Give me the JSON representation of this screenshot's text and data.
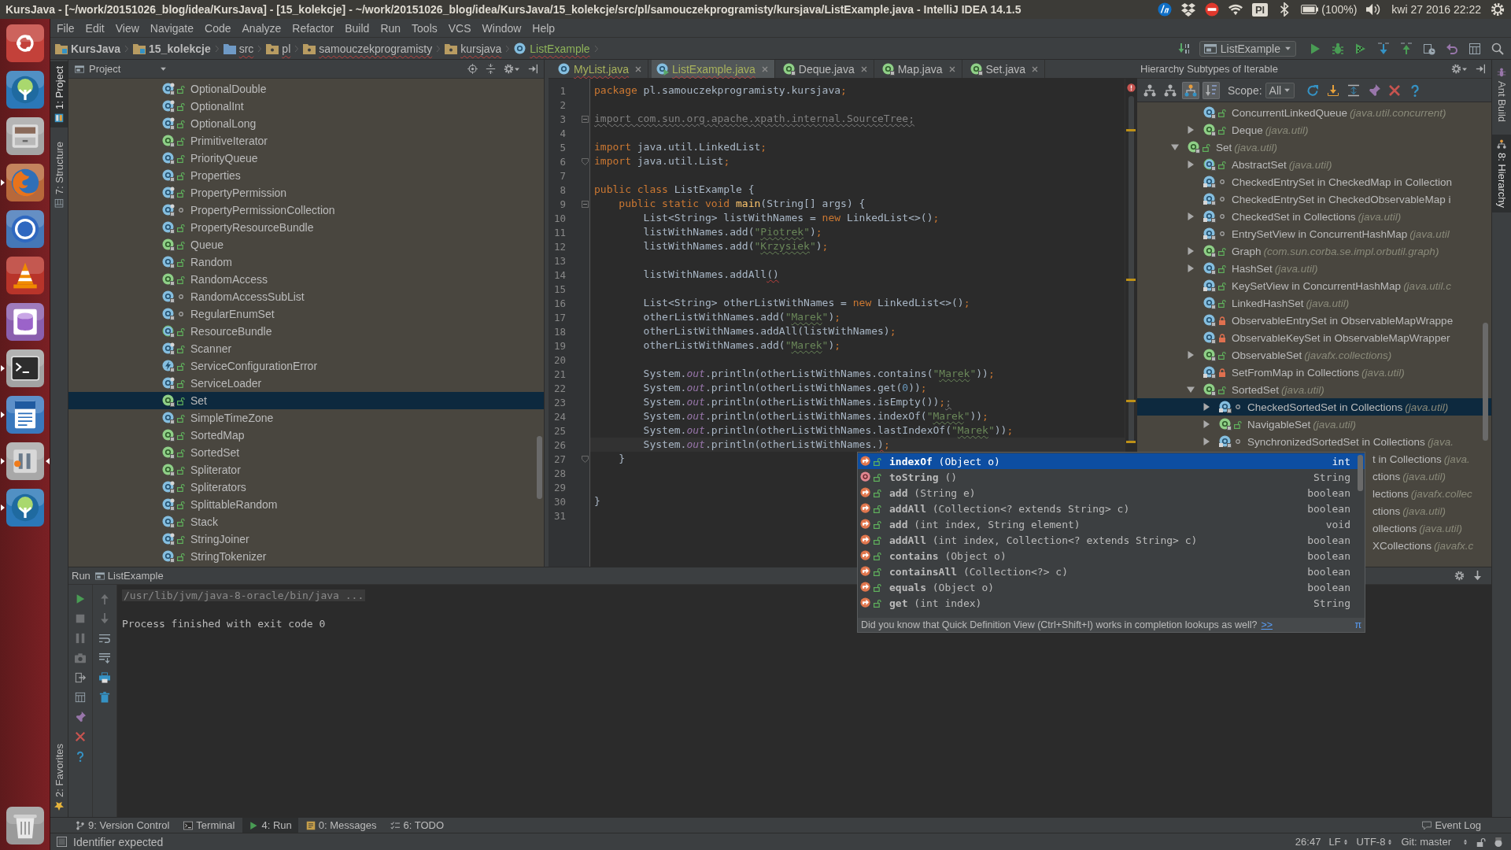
{
  "title_bar": {
    "title": "KursJava - [~/work/20151026_blog/idea/KursJava] - [15_kolekcje] - ~/work/20151026_blog/idea/KursJava/15_kolekcje/src/pl/samouczekprogramisty/kursjava/ListExample.java - IntelliJ IDEA 14.1.5",
    "indicators": [
      {
        "kind": "logo"
      },
      {
        "kind": "box"
      },
      {
        "kind": "blocked"
      },
      {
        "kind": "wifi"
      },
      {
        "kind": "keyboard",
        "label": "Pl"
      },
      {
        "kind": "bluetooth"
      },
      {
        "kind": "battery",
        "label": "(100%)"
      },
      {
        "kind": "volume"
      },
      {
        "kind": "clock",
        "label": "kwi 27 2016 22:22"
      },
      {
        "kind": "gear"
      }
    ]
  },
  "launcher": [
    {
      "kind": "dash",
      "running": false,
      "focused": false
    },
    {
      "kind": "tree",
      "running": false,
      "focused": false
    },
    {
      "kind": "drive",
      "running": false,
      "focused": false
    },
    {
      "kind": "browser",
      "running": true,
      "focused": false
    },
    {
      "kind": "torrent",
      "running": false,
      "focused": false
    },
    {
      "kind": "cone",
      "running": false,
      "focused": false
    },
    {
      "kind": "database",
      "running": false,
      "focused": false
    },
    {
      "kind": "terminal",
      "running": true,
      "focused": false
    },
    {
      "kind": "document",
      "running": true,
      "focused": false
    },
    {
      "kind": "ide",
      "running": true,
      "focused": true
    },
    {
      "kind": "tree",
      "running": true,
      "focused": false
    },
    {
      "kind": "trash",
      "running": false,
      "focused": false
    }
  ],
  "menu": [
    "File",
    "Edit",
    "View",
    "Navigate",
    "Code",
    "Analyze",
    "Refactor",
    "Build",
    "Run",
    "Tools",
    "VCS",
    "Window",
    "Help"
  ],
  "navigation": {
    "breadcrumbs": [
      {
        "label": "KursJava",
        "kind": "project",
        "added": false,
        "errors": false
      },
      {
        "label": "15_kolekcje",
        "kind": "module",
        "added": false,
        "errors": false
      },
      {
        "label": "src",
        "kind": "source",
        "added": false,
        "errors": true
      },
      {
        "label": "pl",
        "kind": "package",
        "added": false,
        "errors": true
      },
      {
        "label": "samouczekprogramisty",
        "kind": "package",
        "added": false,
        "errors": true
      },
      {
        "label": "kursjava",
        "kind": "package",
        "added": false,
        "errors": true
      },
      {
        "label": "ListExample",
        "kind": "class",
        "added": true,
        "errors": true
      }
    ],
    "tools_before": [
      {
        "kind": "make"
      }
    ],
    "run_config": "ListExample",
    "tools_after": [
      {
        "kind": "run"
      },
      {
        "kind": "debug"
      },
      {
        "kind": "coverage"
      },
      {
        "kind": "vcs_update"
      },
      {
        "kind": "vcs_commit"
      },
      {
        "kind": "history"
      },
      {
        "kind": "revert"
      },
      {
        "kind": "structure"
      },
      {
        "kind": "search"
      }
    ]
  },
  "tool_windows": {
    "left_top": [
      {
        "label": "1: Project",
        "kind": "project",
        "selected": true
      },
      {
        "label": "7: Structure",
        "kind": "structure",
        "selected": false
      }
    ],
    "left_bottom": [
      {
        "label": "2: Favorites",
        "kind": "favorites",
        "selected": false
      }
    ],
    "right": [
      {
        "label": "Ant Build",
        "kind": "ant",
        "selected": false
      },
      {
        "label": "8: Hierarchy",
        "kind": "hierarchy",
        "selected": true
      }
    ],
    "bottom": [
      {
        "label": "9: Version Control",
        "kind": "vcs",
        "selected": false
      },
      {
        "label": "Terminal",
        "kind": "terminal",
        "selected": false
      },
      {
        "label": "4: Run",
        "kind": "run",
        "selected": true
      },
      {
        "label": "0: Messages",
        "kind": "messages",
        "selected": false
      },
      {
        "label": "6: TODO",
        "kind": "todo",
        "selected": false
      }
    ],
    "bottom_right": [
      {
        "label": "Event Log",
        "kind": "eventlog",
        "selected": false
      }
    ]
  },
  "project": {
    "title": "Project",
    "items": [
      {
        "name": "OptionalDouble",
        "kind": "finalclass",
        "access": {
          "kind": "public"
        },
        "selected": false
      },
      {
        "name": "OptionalInt",
        "kind": "finalclass",
        "access": {
          "kind": "public"
        },
        "selected": false
      },
      {
        "name": "OptionalLong",
        "kind": "finalclass",
        "access": {
          "kind": "public"
        },
        "selected": false
      },
      {
        "name": "PrimitiveIterator",
        "kind": "interface",
        "access": {
          "kind": "public"
        },
        "selected": false
      },
      {
        "name": "PriorityQueue",
        "kind": "class",
        "access": {
          "kind": "public"
        },
        "selected": false
      },
      {
        "name": "Properties",
        "kind": "class",
        "access": {
          "kind": "public"
        },
        "selected": false
      },
      {
        "name": "PropertyPermission",
        "kind": "finalclass",
        "access": {
          "kind": "public"
        },
        "selected": false
      },
      {
        "name": "PropertyPermissionCollection",
        "kind": "finalclass",
        "access": {
          "kind": "package"
        },
        "selected": false
      },
      {
        "name": "PropertyResourceBundle",
        "kind": "class",
        "access": {
          "kind": "public"
        },
        "selected": false
      },
      {
        "name": "Queue",
        "kind": "interface",
        "access": {
          "kind": "public"
        },
        "selected": false
      },
      {
        "name": "Random",
        "kind": "class",
        "access": {
          "kind": "public"
        },
        "selected": false
      },
      {
        "name": "RandomAccess",
        "kind": "interface",
        "access": {
          "kind": "public"
        },
        "selected": false
      },
      {
        "name": "RandomAccessSubList",
        "kind": "class",
        "access": {
          "kind": "package"
        },
        "selected": false
      },
      {
        "name": "RegularEnumSet",
        "kind": "class",
        "access": {
          "kind": "package"
        },
        "selected": false
      },
      {
        "name": "ResourceBundle",
        "kind": "abstractclass",
        "access": {
          "kind": "public"
        },
        "selected": false
      },
      {
        "name": "Scanner",
        "kind": "finalclass",
        "access": {
          "kind": "public"
        },
        "selected": false
      },
      {
        "name": "ServiceConfigurationError",
        "kind": "exception",
        "access": {
          "kind": "public"
        },
        "selected": false
      },
      {
        "name": "ServiceLoader",
        "kind": "finalclass",
        "access": {
          "kind": "public"
        },
        "selected": false
      },
      {
        "name": "Set",
        "kind": "interface",
        "access": {
          "kind": "public"
        },
        "selected": true
      },
      {
        "name": "SimpleTimeZone",
        "kind": "class",
        "access": {
          "kind": "public"
        },
        "selected": false
      },
      {
        "name": "SortedMap",
        "kind": "interface",
        "access": {
          "kind": "public"
        },
        "selected": false
      },
      {
        "name": "SortedSet",
        "kind": "interface",
        "access": {
          "kind": "public"
        },
        "selected": false
      },
      {
        "name": "Spliterator",
        "kind": "interface",
        "access": {
          "kind": "public"
        },
        "selected": false
      },
      {
        "name": "Spliterators",
        "kind": "finalclass",
        "access": {
          "kind": "public"
        },
        "selected": false
      },
      {
        "name": "SplittableRandom",
        "kind": "finalclass",
        "access": {
          "kind": "public"
        },
        "selected": false
      },
      {
        "name": "Stack",
        "kind": "class",
        "access": {
          "kind": "public"
        },
        "selected": false
      },
      {
        "name": "StringJoiner",
        "kind": "finalclass",
        "access": {
          "kind": "public"
        },
        "selected": false
      },
      {
        "name": "StringTokenizer",
        "kind": "class",
        "access": {
          "kind": "public"
        },
        "selected": false
      }
    ]
  },
  "editor": {
    "tabs": [
      {
        "label": "MyList.java",
        "kind": "class",
        "added": true,
        "library": false,
        "errors": true,
        "selected": false
      },
      {
        "label": "ListExample.java",
        "kind": "runclass",
        "added": true,
        "library": false,
        "errors": true,
        "selected": true
      },
      {
        "label": "Deque.java",
        "kind": "interface",
        "added": false,
        "library": true,
        "errors": false,
        "selected": false
      },
      {
        "label": "Map.java",
        "kind": "interface",
        "added": false,
        "library": true,
        "errors": false,
        "selected": false
      },
      {
        "label": "Set.java",
        "kind": "interface",
        "added": false,
        "library": true,
        "errors": false,
        "selected": false
      }
    ],
    "lines": [
      {
        "number": "1",
        "current": false,
        "tokens": [
          {
            "text": "package",
            "kind": "keyword"
          },
          {
            "text": " pl.samouczekprogramisty.kursjava",
            "kind": "plain"
          },
          {
            "text": ";",
            "kind": "keyword"
          }
        ]
      },
      {
        "number": "2",
        "current": false
      },
      {
        "number": "3",
        "current": false,
        "fold": {
          "kind": "start"
        },
        "tokens": [
          {
            "text": "import com.sun.org.apache.xpath.internal.SourceTree;",
            "kind": "unused"
          }
        ]
      },
      {
        "number": "4",
        "current": false
      },
      {
        "number": "5",
        "current": false,
        "tokens": [
          {
            "text": "import",
            "kind": "keyword"
          },
          {
            "text": " java.util.LinkedList",
            "kind": "plain"
          },
          {
            "text": ";",
            "kind": "keyword"
          }
        ]
      },
      {
        "number": "6",
        "current": false,
        "fold": {
          "kind": "end"
        },
        "tokens": [
          {
            "text": "import",
            "kind": "keyword"
          },
          {
            "text": " java.util.List",
            "kind": "plain"
          },
          {
            "text": ";",
            "kind": "keyword"
          }
        ]
      },
      {
        "number": "7",
        "current": false
      },
      {
        "number": "8",
        "current": false,
        "tokens": [
          {
            "text": "public class",
            "kind": "keyword"
          },
          {
            "text": " ListExample {",
            "kind": "plain"
          }
        ]
      },
      {
        "number": "9",
        "current": false,
        "fold": {
          "kind": "start"
        },
        "tokens": [
          {
            "text": "    public static void ",
            "kind": "keyword"
          },
          {
            "text": "main",
            "kind": "method"
          },
          {
            "text": "(String[] args) {",
            "kind": "plain"
          }
        ]
      },
      {
        "number": "10",
        "current": false,
        "tokens": [
          {
            "text": "        List<String> listWithNames = ",
            "kind": "plain"
          },
          {
            "text": "new",
            "kind": "keyword"
          },
          {
            "text": " LinkedList<>()",
            "kind": "plain"
          },
          {
            "text": ";",
            "kind": "keyword"
          }
        ]
      },
      {
        "number": "11",
        "current": false,
        "tokens": [
          {
            "text": "        listWithNames.add(",
            "kind": "plain"
          },
          {
            "text": "\"",
            "kind": "string"
          },
          {
            "text": "Piotrek",
            "kind": "typo"
          },
          {
            "text": "\"",
            "kind": "string"
          },
          {
            "text": ")",
            "kind": "plain"
          },
          {
            "text": ";",
            "kind": "keyword"
          }
        ]
      },
      {
        "number": "12",
        "current": false,
        "tokens": [
          {
            "text": "        listWithNames.add(",
            "kind": "plain"
          },
          {
            "text": "\"",
            "kind": "string"
          },
          {
            "text": "Krzysiek",
            "kind": "typo"
          },
          {
            "text": "\"",
            "kind": "string"
          },
          {
            "text": ")",
            "kind": "plain"
          },
          {
            "text": ";",
            "kind": "keyword"
          }
        ]
      },
      {
        "number": "13",
        "current": false
      },
      {
        "number": "14",
        "current": false,
        "tokens": [
          {
            "text": "        listWithNames.addAll",
            "kind": "plain"
          },
          {
            "text": "()",
            "kind": "error"
          }
        ]
      },
      {
        "number": "15",
        "current": false
      },
      {
        "number": "16",
        "current": false,
        "tokens": [
          {
            "text": "        List<String> otherListWithNames = ",
            "kind": "plain"
          },
          {
            "text": "new",
            "kind": "keyword"
          },
          {
            "text": " LinkedList<>()",
            "kind": "plain"
          },
          {
            "text": ";",
            "kind": "keyword"
          }
        ]
      },
      {
        "number": "17",
        "current": false,
        "tokens": [
          {
            "text": "        otherListWithNames.add(",
            "kind": "plain"
          },
          {
            "text": "\"",
            "kind": "string"
          },
          {
            "text": "Marek",
            "kind": "typo"
          },
          {
            "text": "\"",
            "kind": "string"
          },
          {
            "text": ")",
            "kind": "plain"
          },
          {
            "text": ";",
            "kind": "keyword"
          }
        ]
      },
      {
        "number": "18",
        "current": false,
        "tokens": [
          {
            "text": "        otherListWithNames.addAll(listWithNames)",
            "kind": "plain"
          },
          {
            "text": ";",
            "kind": "keyword"
          }
        ]
      },
      {
        "number": "19",
        "current": false,
        "tokens": [
          {
            "text": "        otherListWithNames.add(",
            "kind": "plain"
          },
          {
            "text": "\"",
            "kind": "string"
          },
          {
            "text": "Marek",
            "kind": "typo"
          },
          {
            "text": "\"",
            "kind": "string"
          },
          {
            "text": ")",
            "kind": "plain"
          },
          {
            "text": ";",
            "kind": "keyword"
          }
        ]
      },
      {
        "number": "20",
        "current": false
      },
      {
        "number": "21",
        "current": false,
        "tokens": [
          {
            "text": "        System.",
            "kind": "plain"
          },
          {
            "text": "out",
            "kind": "field"
          },
          {
            "text": ".println(otherListWithNames.contains(",
            "kind": "plain"
          },
          {
            "text": "\"",
            "kind": "string"
          },
          {
            "text": "Marek",
            "kind": "typo"
          },
          {
            "text": "\"",
            "kind": "string"
          },
          {
            "text": "))",
            "kind": "plain"
          },
          {
            "text": ";",
            "kind": "keyword"
          }
        ]
      },
      {
        "number": "22",
        "current": false,
        "tokens": [
          {
            "text": "        System.",
            "kind": "plain"
          },
          {
            "text": "out",
            "kind": "field"
          },
          {
            "text": ".println(otherListWithNames.get(",
            "kind": "plain"
          },
          {
            "text": "0",
            "kind": "number"
          },
          {
            "text": "))",
            "kind": "plain"
          },
          {
            "text": ";",
            "kind": "keyword"
          }
        ]
      },
      {
        "number": "23",
        "current": false,
        "tokens": [
          {
            "text": "        System.",
            "kind": "plain"
          },
          {
            "text": "out",
            "kind": "field"
          },
          {
            "text": ".println(otherListWithNames.isEmpty())",
            "kind": "plain"
          },
          {
            "text": ";",
            "kind": "keyword"
          },
          {
            "text": ";",
            "kind": "redundant"
          }
        ]
      },
      {
        "number": "24",
        "current": false,
        "tokens": [
          {
            "text": "        System.",
            "kind": "plain"
          },
          {
            "text": "out",
            "kind": "field"
          },
          {
            "text": ".println(otherListWithNames.indexOf(",
            "kind": "plain"
          },
          {
            "text": "\"",
            "kind": "string"
          },
          {
            "text": "Marek",
            "kind": "typo"
          },
          {
            "text": "\"",
            "kind": "string"
          },
          {
            "text": "))",
            "kind": "plain"
          },
          {
            "text": ";",
            "kind": "keyword"
          }
        ]
      },
      {
        "number": "25",
        "current": false,
        "tokens": [
          {
            "text": "        System.",
            "kind": "plain"
          },
          {
            "text": "out",
            "kind": "field"
          },
          {
            "text": ".println(otherListWithNames.lastIndexOf(",
            "kind": "plain"
          },
          {
            "text": "\"",
            "kind": "string"
          },
          {
            "text": "Marek",
            "kind": "typo"
          },
          {
            "text": "\"",
            "kind": "string"
          },
          {
            "text": "))",
            "kind": "plain"
          },
          {
            "text": ";",
            "kind": "keyword"
          }
        ]
      },
      {
        "number": "26",
        "current": true,
        "tokens": [
          {
            "text": "        System.",
            "kind": "plain"
          },
          {
            "text": "out",
            "kind": "field"
          },
          {
            "text": ".println(otherListWithNames.",
            "kind": "plain"
          },
          {
            "text": ")",
            "kind": "error"
          },
          {
            "text": ";",
            "kind": "keyword"
          }
        ]
      },
      {
        "number": "27",
        "current": false,
        "fold": {
          "kind": "end"
        },
        "tokens": [
          {
            "text": "    }",
            "kind": "plain"
          }
        ]
      },
      {
        "number": "28",
        "current": false
      },
      {
        "number": "29",
        "current": false
      },
      {
        "number": "30",
        "current": false,
        "tokens": [
          {
            "text": "}",
            "kind": "plain"
          }
        ]
      },
      {
        "number": "31",
        "current": false
      }
    ]
  },
  "hierarchy": {
    "title": "Hierarchy Subtypes of Iterable",
    "view_buttons": [
      {
        "kind": "type_hierarchy",
        "on": false
      },
      {
        "kind": "supertypes",
        "on": false
      },
      {
        "kind": "subtypes",
        "on": true
      },
      {
        "kind": "sort",
        "on": true
      }
    ],
    "scope_label": "Scope:",
    "scope": "All",
    "tools": [
      {
        "kind": "refresh"
      },
      {
        "kind": "export"
      },
      {
        "kind": "expand_all"
      },
      {
        "kind": "pin"
      },
      {
        "kind": "close"
      },
      {
        "kind": "help"
      }
    ],
    "hidden_parent_children": [
      {
        "name": "ConcurrentLinkedQueue",
        "package": "(java.util.concurrent)",
        "kind": "class",
        "access": {
          "kind": "public"
        },
        "selected": false
      },
      {
        "name": "Deque",
        "package": "(java.util)",
        "kind": "interface",
        "access": {
          "kind": "public"
        },
        "expanded": false,
        "selected": false
      }
    ],
    "nodes": [
      {
        "name": "Set",
        "package": "(java.util)",
        "kind": "interface",
        "access": {
          "kind": "public"
        },
        "expanded": true,
        "selected": false,
        "children": [
          {
            "name": "AbstractSet",
            "package": "(java.util)",
            "kind": "abstractclass",
            "access": {
              "kind": "public"
            },
            "expanded": false,
            "selected": false
          },
          {
            "name": "CheckedEntrySet in CheckedMap in Collection",
            "kind": "staticclass",
            "access": {
              "kind": "package"
            },
            "selected": false
          },
          {
            "name": "CheckedEntrySet in CheckedObservableMap i",
            "kind": "staticclass",
            "access": {
              "kind": "package"
            },
            "selected": false
          },
          {
            "name": "CheckedSet in Collections",
            "package": "(java.util)",
            "kind": "staticclass",
            "access": {
              "kind": "package"
            },
            "expanded": false,
            "selected": false
          },
          {
            "name": "EntrySetView in ConcurrentHashMap",
            "package": "(java.util",
            "kind": "staticclass",
            "access": {
              "kind": "package"
            },
            "selected": false
          },
          {
            "name": "Graph",
            "package": "(com.sun.corba.se.impl.orbutil.graph)",
            "kind": "interface",
            "access": {
              "kind": "public"
            },
            "expanded": false,
            "selected": false
          },
          {
            "name": "HashSet",
            "package": "(java.util)",
            "kind": "class",
            "access": {
              "kind": "public"
            },
            "expanded": false,
            "selected": false
          },
          {
            "name": "KeySetView in ConcurrentHashMap",
            "package": "(java.util.c",
            "kind": "staticclass",
            "access": {
              "kind": "public"
            },
            "selected": false
          },
          {
            "name": "LinkedHashSet",
            "package": "(java.util)",
            "kind": "class",
            "access": {
              "kind": "public"
            },
            "selected": false
          },
          {
            "name": "ObservableEntrySet in ObservableMapWrappe",
            "kind": "class",
            "access": {
              "kind": "private"
            },
            "selected": false
          },
          {
            "name": "ObservableKeySet in ObservableMapWrapper",
            "kind": "class",
            "access": {
              "kind": "private"
            },
            "selected": false
          },
          {
            "name": "ObservableSet",
            "package": "(javafx.collections)",
            "kind": "interface",
            "access": {
              "kind": "public"
            },
            "expanded": false,
            "selected": false
          },
          {
            "name": "SetFromMap in Collections",
            "package": "(java.util)",
            "kind": "staticclass",
            "access": {
              "kind": "private"
            },
            "selected": false
          },
          {
            "name": "SortedSet",
            "package": "(java.util)",
            "kind": "interface",
            "access": {
              "kind": "public"
            },
            "expanded": true,
            "selected": false,
            "children": [
              {
                "name": "CheckedSortedSet in Collections",
                "package": "(java.util)",
                "kind": "staticclass",
                "access": {
                  "kind": "package"
                },
                "expanded": false,
                "selected": true
              },
              {
                "name": "NavigableSet",
                "package": "(java.util)",
                "kind": "interface",
                "access": {
                  "kind": "public"
                },
                "expanded": false,
                "selected": false
              },
              {
                "name": "SynchronizedSortedSet in Collections",
                "package": "(java.",
                "kind": "staticclass",
                "access": {
                  "kind": "package"
                },
                "expanded": false,
                "selected": false
              }
            ]
          }
        ]
      }
    ],
    "covered_rows": [
      {
        "name": "t in Collections",
        "package": "(java."
      },
      {
        "name": "ctions",
        "package": "(java.util)"
      },
      {
        "name": "lections",
        "package": "(javafx.collec"
      },
      {
        "name": "ctions",
        "package": "(java.util)"
      },
      {
        "name": "ollections",
        "package": "(java.util)"
      },
      {
        "name": "XCollections",
        "package": "(javafx.c"
      }
    ]
  },
  "completion": {
    "items": [
      {
        "name": "indexOf",
        "params": "(Object o)",
        "type": "int",
        "kind": "implementing",
        "access": {
          "kind": "public"
        },
        "selected": true
      },
      {
        "name": "toString",
        "params": "()",
        "type": "String",
        "kind": "method",
        "access": {
          "kind": "public"
        },
        "selected": false
      },
      {
        "name": "add",
        "params": "(String e)",
        "type": "boolean",
        "kind": "implementing",
        "access": {
          "kind": "public"
        },
        "selected": false
      },
      {
        "name": "addAll",
        "params": "(Collection<? extends String> c)",
        "type": "boolean",
        "kind": "implementing",
        "access": {
          "kind": "public"
        },
        "selected": false
      },
      {
        "name": "add",
        "params": "(int index, String element)",
        "type": "void",
        "kind": "implementing",
        "access": {
          "kind": "public"
        },
        "selected": false
      },
      {
        "name": "addAll",
        "params": "(int index, Collection<? extends String> c)",
        "type": "boolean",
        "kind": "implementing",
        "access": {
          "kind": "public"
        },
        "selected": false
      },
      {
        "name": "contains",
        "params": "(Object o)",
        "type": "boolean",
        "kind": "implementing",
        "access": {
          "kind": "public"
        },
        "selected": false
      },
      {
        "name": "containsAll",
        "params": "(Collection<?> c)",
        "type": "boolean",
        "kind": "implementing",
        "access": {
          "kind": "public"
        },
        "selected": false
      },
      {
        "name": "equals",
        "params": "(Object o)",
        "type": "boolean",
        "kind": "implementing",
        "access": {
          "kind": "public"
        },
        "selected": false
      },
      {
        "name": "get",
        "params": "(int index)",
        "type": "String",
        "kind": "implementing",
        "access": {
          "kind": "public"
        },
        "selected": false
      }
    ],
    "hint": "Did you know that Quick Definition View (Ctrl+Shift+I) works in completion lookups as well?",
    "hint_link": ">>",
    "hint_mark": "π"
  },
  "run": {
    "title": "Run",
    "tab": "ListExample",
    "left_tools": [
      {
        "kind": "rerun",
        "disabled": false
      },
      {
        "kind": "stop",
        "disabled": true
      },
      {
        "kind": "pause",
        "disabled": true
      },
      {
        "kind": "dump",
        "disabled": true
      },
      {
        "kind": "exit",
        "disabled": false
      },
      {
        "kind": "layout",
        "disabled": false
      },
      {
        "kind": "pin",
        "disabled": false
      },
      {
        "kind": "close",
        "disabled": false
      },
      {
        "kind": "help",
        "disabled": false
      }
    ],
    "right_tools": [
      {
        "kind": "up",
        "disabled": true
      },
      {
        "kind": "down",
        "disabled": true
      },
      {
        "kind": "wrap",
        "disabled": false
      },
      {
        "kind": "scroll_end",
        "disabled": false
      },
      {
        "kind": "print",
        "disabled": false
      },
      {
        "kind": "clear",
        "disabled": false
      }
    ],
    "console": [
      {
        "text": "/usr/lib/jvm/java-8-oracle/bin/java ...",
        "kind": "folded"
      },
      {
        "text": "Process finished with exit code 0",
        "kind": "output"
      }
    ]
  },
  "status_bar": {
    "message": "Identifier expected",
    "position": "26:47",
    "line_separator": "LF",
    "encoding": "UTF-8",
    "vcs_branch": "Git: master"
  }
}
